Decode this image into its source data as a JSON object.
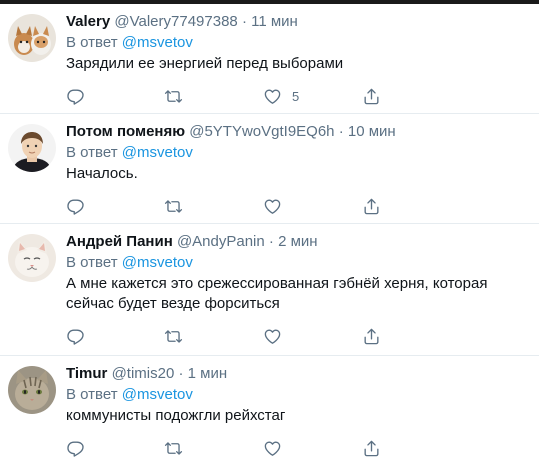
{
  "tweets": [
    {
      "name": "Valery",
      "handle": "@Valery77497388",
      "dot": "·",
      "time": "11 мин",
      "reply_prefix": "В ответ ",
      "reply_to": "@msvetov",
      "text": "Зарядили ее энергией перед выборами",
      "like_count": "5",
      "avatar": "dogs-avatar"
    },
    {
      "name": "Потом поменяю",
      "handle": "@5YTYwoVgtI9EQ6h",
      "dot": "·",
      "time": "10 мин",
      "reply_prefix": "В ответ ",
      "reply_to": "@msvetov",
      "text": "Началось.",
      "like_count": "",
      "avatar": "child-avatar"
    },
    {
      "name": "Андрей Панин",
      "handle": "@AndyPanin",
      "dot": "·",
      "time": "2 мин",
      "reply_prefix": "В ответ ",
      "reply_to": "@msvetov",
      "text": "А мне кажется это срежессированная гэбнёй херня, которая сейчас будет везде форситься",
      "like_count": "",
      "avatar": "cat-avatar"
    },
    {
      "name": "Timur",
      "handle": "@timis20",
      "dot": "·",
      "time": "1 мин",
      "reply_prefix": "В ответ ",
      "reply_to": "@msvetov",
      "text": "коммунисты подожгли рейхстаг",
      "like_count": "",
      "avatar": "tabby-cat-avatar"
    }
  ],
  "colors": {
    "text": "#0f1419",
    "secondary": "#5b7083",
    "link": "#1b95e0",
    "divider": "#e6ecf0"
  }
}
